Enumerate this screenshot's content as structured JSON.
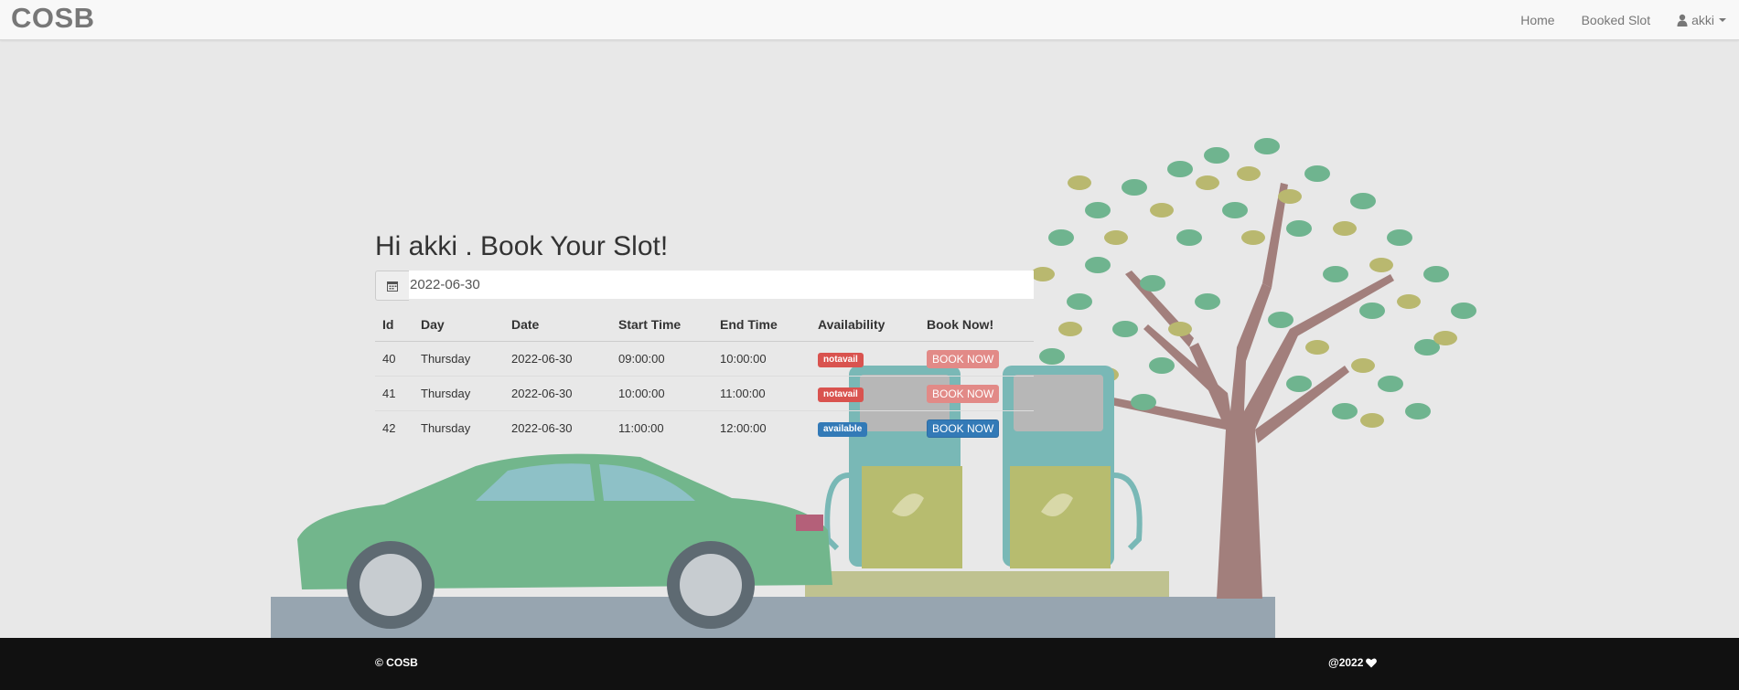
{
  "navbar": {
    "brand": "COSB",
    "links": [
      {
        "label": "Home"
      },
      {
        "label": "Booked Slot"
      }
    ],
    "user": {
      "label": "akki",
      "icon": "user-icon"
    }
  },
  "booking": {
    "heading": "Hi akki . Book Your Slot!",
    "date_value": "2022-06-30",
    "date_icon": "calendar-icon",
    "columns": [
      "Id",
      "Day",
      "Date",
      "Start Time",
      "End Time",
      "Availability",
      "Book Now!"
    ],
    "rows": [
      {
        "id": "40",
        "day": "Thursday",
        "date": "2022-06-30",
        "start": "09:00:00",
        "end": "10:00:00",
        "availability": "notavail",
        "button": "BOOK NOW"
      },
      {
        "id": "41",
        "day": "Thursday",
        "date": "2022-06-30",
        "start": "10:00:00",
        "end": "11:00:00",
        "availability": "notavail",
        "button": "BOOK NOW"
      },
      {
        "id": "42",
        "day": "Thursday",
        "date": "2022-06-30",
        "start": "11:00:00",
        "end": "12:00:00",
        "availability": "available",
        "button": "BOOK NOW"
      }
    ]
  },
  "footer": {
    "left": "© COSB",
    "right": "@2022",
    "right_icon": "heart-icon"
  },
  "colors": {
    "danger": "#d9534f",
    "primary": "#337ab7",
    "footer_bg": "#111111"
  }
}
